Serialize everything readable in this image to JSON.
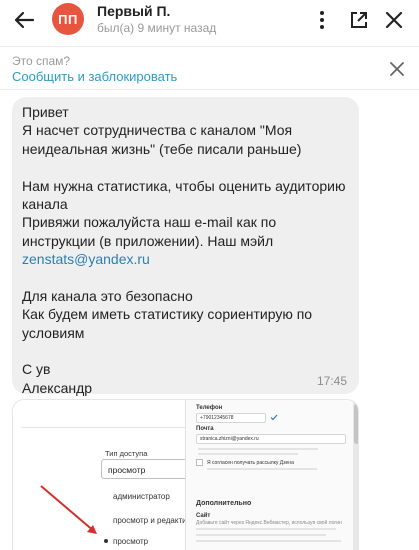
{
  "header": {
    "avatar_initials": "ПП",
    "avatar_color": "#e8553f",
    "name": "Первый П.",
    "status": "был(а) 9 минут назад",
    "icons": [
      "back-arrow-icon",
      "more-vertical-icon",
      "open-external-icon",
      "close-icon"
    ]
  },
  "spam": {
    "question": "Это спам?",
    "action": "Сообщить и заблокировать",
    "link_color": "#2b9fc3"
  },
  "message": {
    "lines": [
      "Привет",
      "Я насчет сотрудничества с каналом \"Моя",
      "неидеальная жизнь\" (тебе писали раньше)",
      "",
      "Нам нужна статистика, чтобы оценить аудиторию",
      "канала",
      "Привяжи пожалуйста наш e-mail как по",
      "инструкции (в приложении). Наш мэйл",
      "zenstats@yandex.ru",
      "",
      "Для канала это безопасно",
      "Как будем иметь статистику сориентирую по",
      "условиям",
      "",
      "С ув",
      "Александр"
    ],
    "time": "17:45"
  },
  "attachment": {
    "access_label": "Тип доступа",
    "access_value": "просмотр",
    "options": [
      "администратор",
      "просмотр и редактир",
      "просмотр"
    ],
    "right_panel": {
      "phone_label": "Телефон",
      "phone_value": "+79012345678",
      "email_label": "Почта",
      "email_value": "stranica.zhizni@yandex.ru",
      "consent_text": "Я согласен получать рассылку Дзена",
      "section_title": "Дополнительно",
      "site_label": "Сайт",
      "site_hint": "Добавьте сайт через Яндекс.Вебмастер, используя свой логин"
    }
  }
}
